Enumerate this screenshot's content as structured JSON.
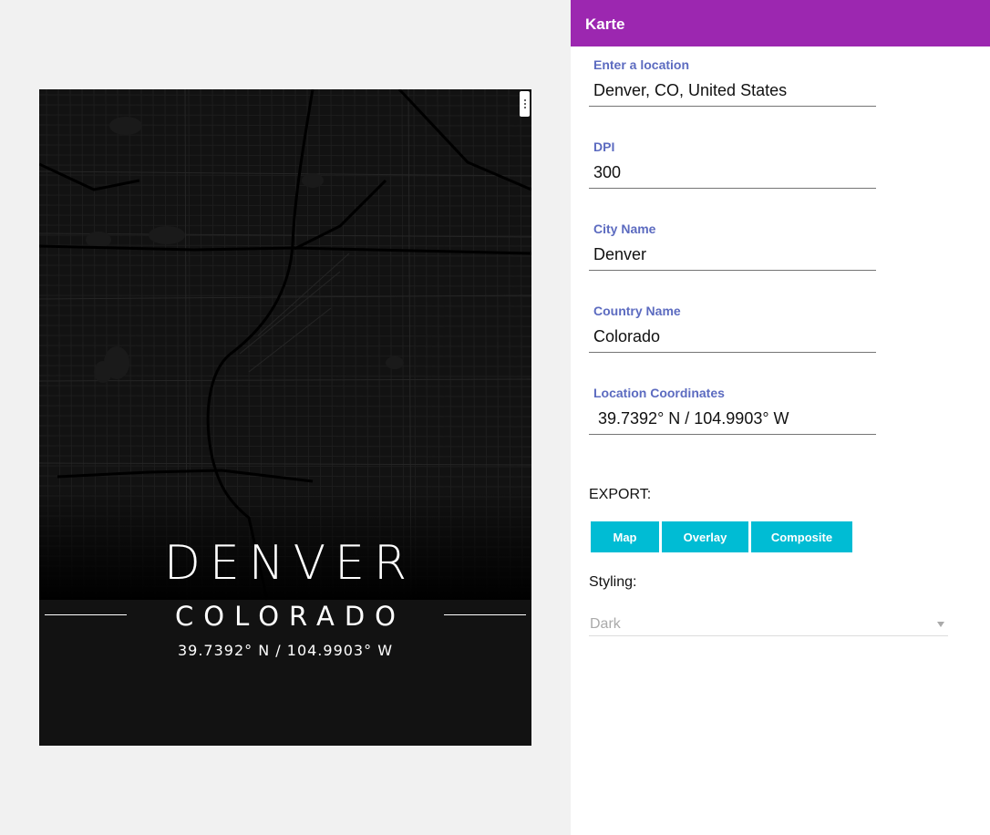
{
  "poster": {
    "city": "DENVER",
    "country": "COLORADO",
    "coordinates": "39.7392° N / 104.9903° W"
  },
  "panel": {
    "title": "Karte",
    "fields": {
      "location": {
        "label": "Enter a location",
        "value": "Denver, CO, United States"
      },
      "dpi": {
        "label": "DPI",
        "value": "300"
      },
      "city": {
        "label": "City Name",
        "value": "Denver"
      },
      "country": {
        "label": "Country Name",
        "value": "Colorado"
      },
      "coords": {
        "label": "Location Coordinates",
        "value": " 39.7392° N / 104.9903° W"
      }
    },
    "export_label": "EXPORT:",
    "buttons": {
      "map": "Map",
      "overlay": "Overlay",
      "composite": "Composite"
    },
    "styling_label": "Styling:",
    "styling_value": "Dark"
  },
  "colors": {
    "header": "#9c27b0",
    "button": "#00bcd4",
    "label": "#5c6bc0"
  }
}
